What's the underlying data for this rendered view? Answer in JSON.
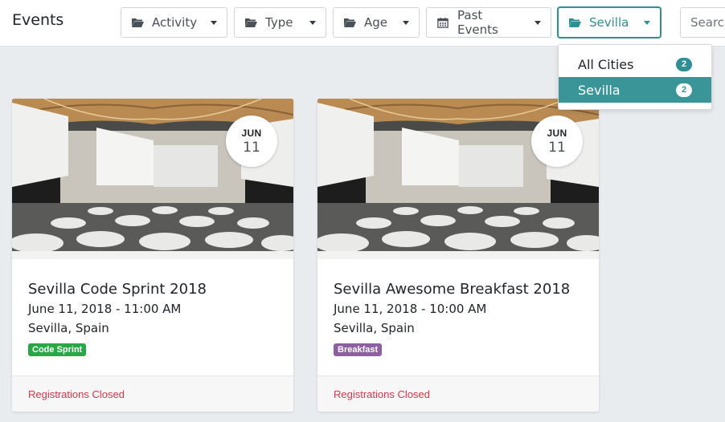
{
  "header": {
    "title": "Events",
    "search_placeholder": "Search"
  },
  "filters": [
    {
      "label": "Activity",
      "icon": "folder-open-icon"
    },
    {
      "label": "Type",
      "icon": "folder-open-icon"
    },
    {
      "label": "Age",
      "icon": "folder-open-icon"
    },
    {
      "label": "Past Events",
      "icon": "calendar-icon"
    },
    {
      "label": "Sevilla",
      "icon": "folder-open-icon"
    }
  ],
  "city_dropdown": {
    "items": [
      {
        "label": "All Cities",
        "count": "2"
      },
      {
        "label": "Sevilla",
        "count": "2"
      }
    ]
  },
  "events": [
    {
      "month": "JUN",
      "day": "11",
      "title": "Sevilla Code Sprint 2018",
      "datetime": "June 11, 2018 - 11:00 AM",
      "location": "Sevilla, Spain",
      "tag": "Code Sprint",
      "tag_color": "#28a745",
      "status": "Registrations Closed"
    },
    {
      "month": "JUN",
      "day": "11",
      "title": "Sevilla Awesome Breakfast 2018",
      "datetime": "June 11, 2018 - 10:00 AM",
      "location": "Sevilla, Spain",
      "tag": "Breakfast",
      "tag_color": "#8e5ea2",
      "status": "Registrations Closed"
    }
  ],
  "colors": {
    "accent": "#2f8f94",
    "selected_bg": "#3a9599",
    "status_red": "#dc3545"
  }
}
